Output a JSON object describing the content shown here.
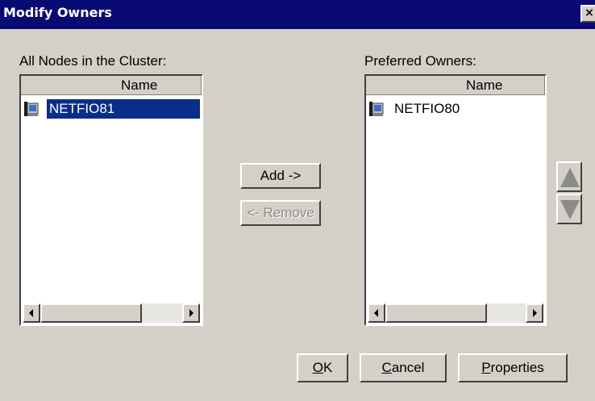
{
  "window": {
    "title": "Modify Owners",
    "close_glyph": "×"
  },
  "left_panel": {
    "label": "All Nodes in the Cluster:",
    "column_header": "Name",
    "items": [
      {
        "name": "NETFIO81",
        "icon": "server-icon",
        "selected": true
      }
    ]
  },
  "right_panel": {
    "label": "Preferred Owners:",
    "column_header": "Name",
    "items": [
      {
        "name": "NETFIO80",
        "icon": "server-icon",
        "selected": false
      }
    ]
  },
  "buttons": {
    "add": "Add ->",
    "remove": "<- Remove",
    "move_up_icon": "triangle-up-icon",
    "move_down_icon": "triangle-down-icon",
    "ok": "OK",
    "ok_mnemonic": "O",
    "ok_rest": "K",
    "cancel": "Cancel",
    "cancel_mnemonic": "C",
    "cancel_rest": "ancel",
    "properties": "Properties",
    "properties_mnemonic": "P",
    "properties_rest": "roperties"
  },
  "colors": {
    "title_bar": "#0a0a74",
    "selection": "#0a2d8a",
    "face": "#d4d0c8"
  }
}
